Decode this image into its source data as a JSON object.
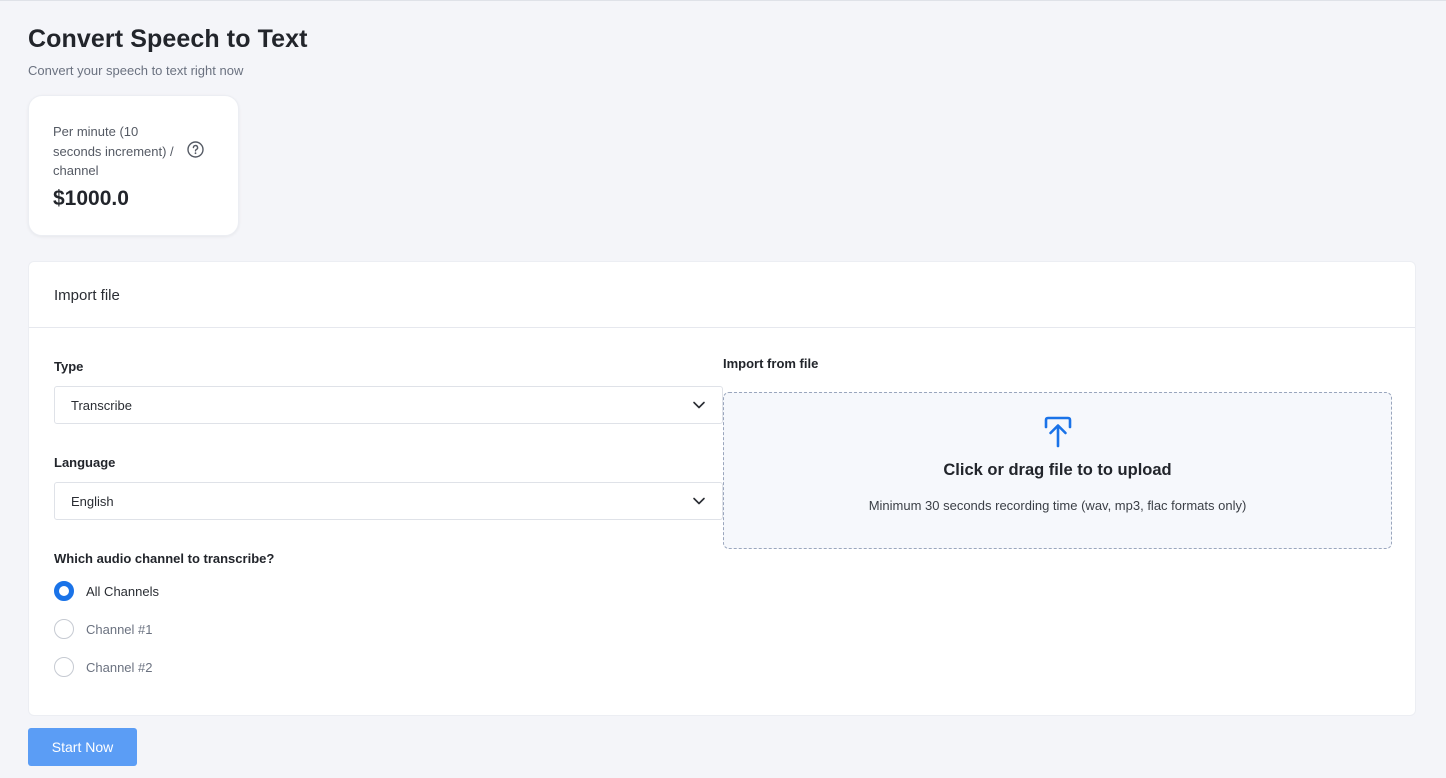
{
  "header": {
    "title": "Convert Speech to Text",
    "subtitle": "Convert your speech to text right now"
  },
  "price_card": {
    "label": "Per minute (10 seconds increment) / channel",
    "value": "$1000.0",
    "help_icon": "question-circle-icon"
  },
  "import_panel": {
    "title": "Import file",
    "type_field": {
      "label": "Type",
      "value": "Transcribe"
    },
    "language_field": {
      "label": "Language",
      "value": "English"
    },
    "channel_question": "Which audio channel to transcribe?",
    "channel_options": [
      {
        "label": "All Channels",
        "selected": true
      },
      {
        "label": "Channel #1",
        "selected": false
      },
      {
        "label": "Channel #2",
        "selected": false
      }
    ],
    "dropzone": {
      "label": "Import from file",
      "title": "Click or drag file to to upload",
      "hint": "Minimum 30 seconds recording time (wav, mp3, flac formats only)",
      "icon": "upload-arrow-icon"
    }
  },
  "actions": {
    "start_label": "Start Now"
  },
  "colors": {
    "accent": "#1a73e8",
    "button": "#5b9df5",
    "background": "#f4f5f9"
  }
}
